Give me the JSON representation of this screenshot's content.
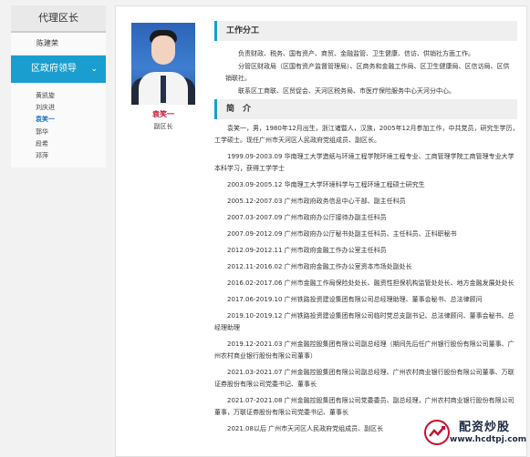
{
  "sidebar": {
    "header": "代理区长",
    "top_item": "陈建荣",
    "active_section": "区政府领导",
    "sub_items": [
      "黄凯旋",
      "刘庆进",
      "袁笑一",
      "郭华",
      "段希",
      "邓萍"
    ],
    "current_index": 2
  },
  "person": {
    "name": "袁笑一",
    "title": "副区长"
  },
  "duties": {
    "heading": "工作分工",
    "paragraphs": [
      "负责财政、税务、国有资产、商贸、金融监管、卫生健康、信访、供销社方面工作。",
      "分管区财政局（区国有资产监督管理局）、区商务和金融工作局、区卫生健康局、区信访局、区供销联社。",
      "联系区工商联、区贸促会、天河区税务局、市医疗保险服务中心天河分中心。"
    ]
  },
  "intro": {
    "heading": "简　介",
    "summary": "袁笑一，男，1980年12月出生，浙江诸暨人，汉族，2005年12月参加工作，中共党员，研究生学历，工学硕士。现任广州市天河区人民政府党组成员、副区长。",
    "resume": [
      "1999.09-2003.09  华南理工大学造纸与环境工程学院环境工程专业、工商管理学院工商管理专业大学本科学习，获得工学学士",
      "2003.09-2005.12  华南理工大学环境科学与工程环境工程硕士研究生",
      "2005.12-2007.03  广州市政府政务信息中心干部、副主任科员",
      "2007.03-2007.09  广州市政府办公厅接待办副主任科员",
      "2007.09-2012.09  广州市政府办公厅秘书处副主任科员、主任科员、正科职秘书",
      "2012.09-2012.11  广州市政府金融工作办公室主任科员",
      "2012.11-2016.02  广州市政府金融工作办公室资本市场处副处长",
      "2016.02-2017.06  广州市金融工作局保险处处长、融资性担保机构监管处处长、地方金融发展处处长",
      "2017.06-2019.10  广州铁路投资建设集团有限公司总经理助理、董事会秘书、总法律顾问",
      "2019.10-2019.12  广州铁路投资建设集团有限公司临时党总支副书记、总法律顾问、董事会秘书、总经理助理",
      "2019.12-2021.03  广州金融控股集团有限公司副总经理（期间先后任广州银行股份有限公司董事、广州农村商业银行股份有限公司董事）",
      "2021.03-2021.07  广州金融控股集团有限公司副总经理、广州农村商业银行股份有限公司董事、万联证券股份有限公司党委书记、董事长",
      "2021.07-2021.08  广州金融控股集团有限公司党委委员、副总经理，广州农村商业银行股份有限公司董事，万联证券股份有限公司党委书记、董事长",
      "2021.08以后      广州市天河区人民政府党组成员、副区长"
    ]
  },
  "watermark": {
    "title": "配资炒股",
    "url": "www.hcdtpj.com"
  }
}
